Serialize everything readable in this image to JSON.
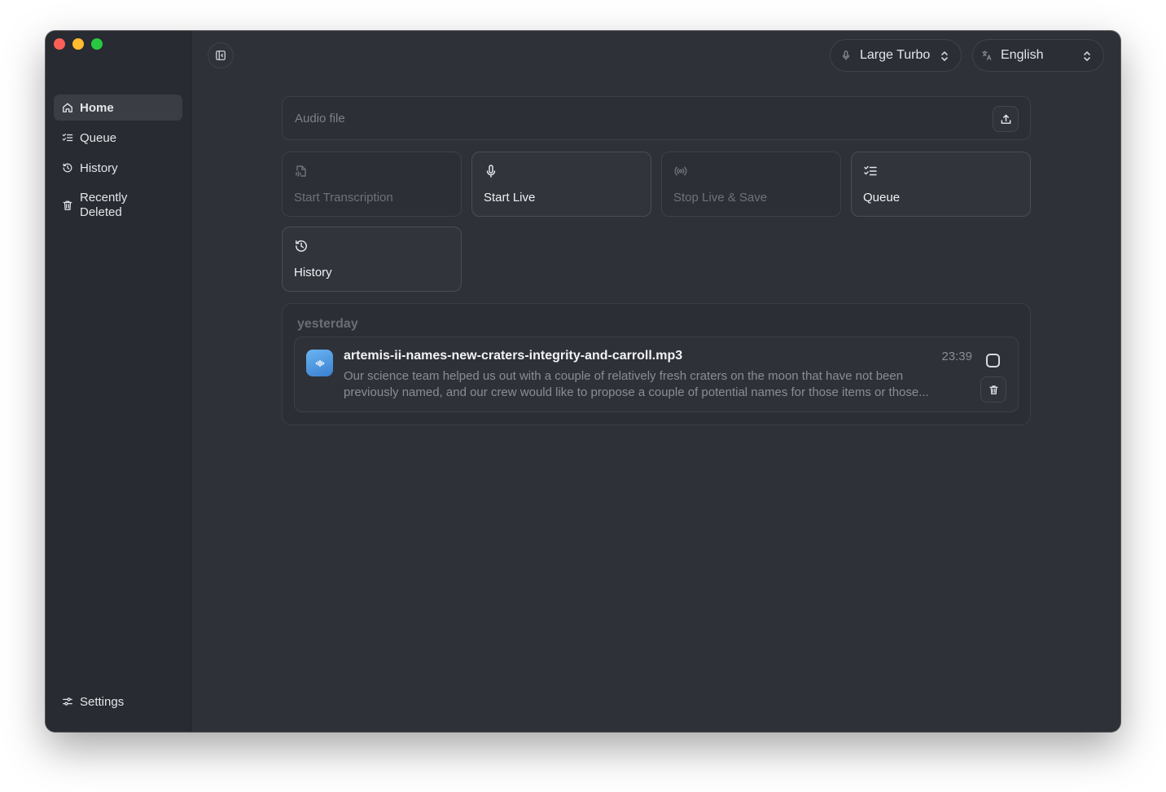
{
  "sidebar": {
    "items": [
      {
        "label": "Home",
        "icon": "home-icon",
        "active": true
      },
      {
        "label": "Queue",
        "icon": "list-check-icon"
      },
      {
        "label": "History",
        "icon": "history-icon"
      },
      {
        "label_line1": "Recently",
        "label_line2": "Deleted",
        "icon": "trash-icon"
      }
    ],
    "settings_label": "Settings"
  },
  "toolbar": {
    "model": "Large Turbo",
    "language": "English"
  },
  "audio_file": {
    "placeholder": "Audio file"
  },
  "actions": [
    {
      "label": "Start Transcription",
      "icon": "file-audio-icon",
      "enabled": false
    },
    {
      "label": "Start Live",
      "icon": "microphone-icon",
      "enabled": true
    },
    {
      "label": "Stop Live & Save",
      "icon": "broadcast-icon",
      "enabled": false
    },
    {
      "label": "Queue",
      "icon": "list-check-icon",
      "enabled": true
    },
    {
      "label": "History",
      "icon": "history-icon",
      "enabled": true
    }
  ],
  "recent": {
    "group_label": "yesterday",
    "items": [
      {
        "title": "artemis-ii-names-new-craters-integrity-and-carroll.mp3",
        "time": "23:39",
        "desc_line1": "Our science team helped us out with a couple of relatively fresh craters on the moon that have not been",
        "desc_line2": "previously named, and our crew would like to propose a couple of potential names for those items or those..."
      }
    ]
  },
  "colors": {
    "window_bg": "#2e3138",
    "sidebar_bg": "#282b31",
    "accent_icon": "#4a90e2"
  }
}
